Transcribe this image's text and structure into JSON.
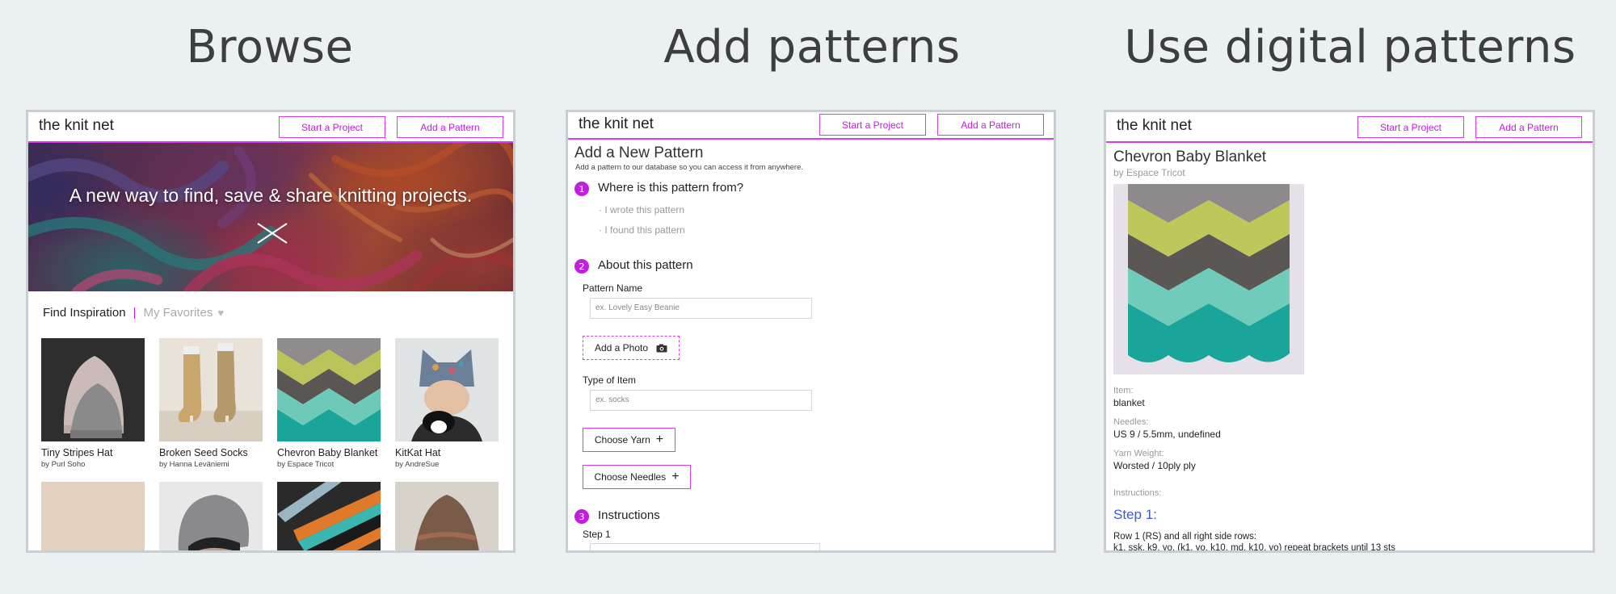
{
  "sections": {
    "browse_title": "Browse",
    "add_title": "Add patterns",
    "use_title": "Use digital patterns"
  },
  "nav": {
    "logo": "the knit net",
    "start_project": "Start a Project",
    "add_pattern": "Add a Pattern"
  },
  "browse": {
    "hero_text": "A new way to find, save & share knitting projects.",
    "tab_active": "Find Inspiration",
    "tab_separator": "|",
    "tab_inactive": "My Favorites",
    "heart_icon": "♥",
    "cards": [
      {
        "title": "Tiny Stripes Hat",
        "author": "by Purl Soho"
      },
      {
        "title": "Broken Seed Socks",
        "author": "by Hanna Leväniemi"
      },
      {
        "title": "Chevron Baby Blanket",
        "author": "by Espace Tricot"
      },
      {
        "title": "KitKat Hat",
        "author": "by AndreSue"
      }
    ]
  },
  "add": {
    "title": "Add a New Pattern",
    "subtitle": "Add a pattern to our database so you can access it from anywhere.",
    "steps": [
      {
        "num": "1",
        "label": "Where is this pattern from?"
      },
      {
        "num": "2",
        "label": "About this pattern"
      },
      {
        "num": "3",
        "label": "Instructions"
      }
    ],
    "option_wrote": "· I wrote this pattern",
    "option_found": "· I found this pattern",
    "pattern_name_label": "Pattern Name",
    "pattern_name_placeholder": "ex. Lovely Easy Beanie",
    "add_photo": "Add a Photo",
    "type_label": "Type of Item",
    "type_placeholder": "ex. socks",
    "choose_yarn": "Choose Yarn",
    "choose_needles": "Choose Needles",
    "plus_icon": "+",
    "step1_label": "Step 1"
  },
  "pattern": {
    "title": "Chevron Baby Blanket",
    "author": "by Espace Tricot",
    "item_label": "Item:",
    "item_value": "blanket",
    "needles_label": "Needles:",
    "needles_value": "US 9 / 5.5mm, undefined",
    "yarn_label": "Yarn Weight:",
    "yarn_value": "Worsted / 10ply ply",
    "instructions_label": "Instructions:",
    "step_heading": "Step 1:",
    "instr_line1": "Row 1 (RS) and all right side rows:",
    "instr_line2": "k1, ssk, k9, yo, (k1, yo, k10, md, k10, yo) repeat brackets until 13 sts"
  },
  "colors": {
    "accent": "#c21ee0",
    "accent_border": "#d63cf0",
    "step_link": "#3b5bd6",
    "background": "#ebf0f0"
  }
}
